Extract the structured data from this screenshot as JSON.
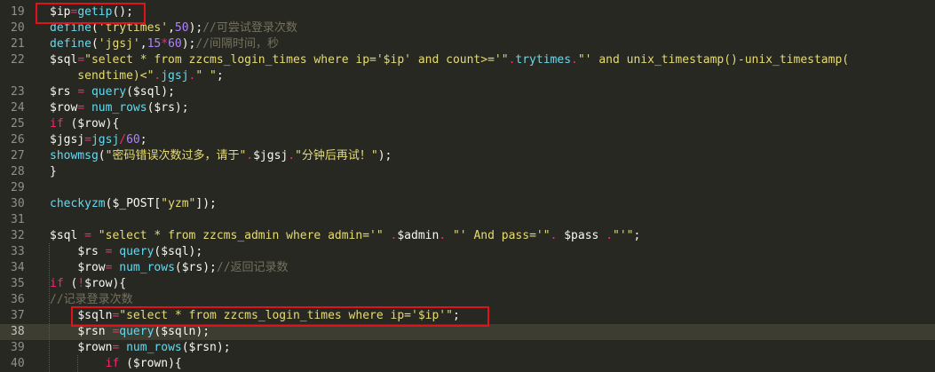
{
  "editor": {
    "lines": [
      {
        "num": "19",
        "tokens": [
          [
            "var",
            "$ip"
          ],
          [
            "op",
            "="
          ],
          [
            "fn",
            "getip"
          ],
          [
            "pu",
            "();"
          ]
        ]
      },
      {
        "num": "20",
        "tokens": [
          [
            "fn",
            "define"
          ],
          [
            "pu",
            "("
          ],
          [
            "str",
            "'trytimes'"
          ],
          [
            "pu",
            ","
          ],
          [
            "num",
            "50"
          ],
          [
            "pu",
            ");"
          ],
          [
            "cm",
            "//可尝试登录次数"
          ]
        ]
      },
      {
        "num": "21",
        "tokens": [
          [
            "fn",
            "define"
          ],
          [
            "pu",
            "("
          ],
          [
            "str",
            "'jgsj'"
          ],
          [
            "pu",
            ","
          ],
          [
            "num",
            "15"
          ],
          [
            "op",
            "*"
          ],
          [
            "num",
            "60"
          ],
          [
            "pu",
            ");"
          ],
          [
            "cm",
            "//间隔时间，秒"
          ]
        ]
      },
      {
        "num": "22",
        "tokens": [
          [
            "var",
            "$sql"
          ],
          [
            "op",
            "="
          ],
          [
            "str",
            "\"select * from zzcms_login_times where ip='$ip' and count>='\""
          ],
          [
            "op",
            "."
          ],
          [
            "fn",
            "trytimes"
          ],
          [
            "op",
            "."
          ],
          [
            "str",
            "\"' and unix_timestamp()-unix_timestamp("
          ]
        ]
      },
      {
        "num": "",
        "tokens": [
          [
            "str",
            "    sendtime)<\""
          ],
          [
            "op",
            "."
          ],
          [
            "fn",
            "jgsj"
          ],
          [
            "op",
            "."
          ],
          [
            "str",
            "\" \""
          ],
          [
            "pu",
            ";"
          ]
        ]
      },
      {
        "num": "23",
        "tokens": [
          [
            "var",
            "$rs"
          ],
          [
            "pu",
            " "
          ],
          [
            "op",
            "="
          ],
          [
            "pu",
            " "
          ],
          [
            "fn",
            "query"
          ],
          [
            "pu",
            "($sql);"
          ]
        ]
      },
      {
        "num": "24",
        "tokens": [
          [
            "var",
            "$row"
          ],
          [
            "op",
            "="
          ],
          [
            "pu",
            " "
          ],
          [
            "fn",
            "num_rows"
          ],
          [
            "pu",
            "($rs);"
          ]
        ]
      },
      {
        "num": "25",
        "tokens": [
          [
            "kw",
            "if"
          ],
          [
            "pu",
            " ($row){"
          ]
        ]
      },
      {
        "num": "26",
        "tokens": [
          [
            "var",
            "$jgsj"
          ],
          [
            "op",
            "="
          ],
          [
            "fn",
            "jgsj"
          ],
          [
            "op",
            "/"
          ],
          [
            "num",
            "60"
          ],
          [
            "pu",
            ";"
          ]
        ]
      },
      {
        "num": "27",
        "tokens": [
          [
            "fn",
            "showmsg"
          ],
          [
            "pu",
            "("
          ],
          [
            "str",
            "\"密码错误次数过多，请于\""
          ],
          [
            "op",
            "."
          ],
          [
            "var",
            "$jgsj"
          ],
          [
            "op",
            "."
          ],
          [
            "str",
            "\"分钟后再试！\""
          ],
          [
            "pu",
            ");"
          ]
        ]
      },
      {
        "num": "28",
        "tokens": [
          [
            "pu",
            "}"
          ]
        ]
      },
      {
        "num": "29",
        "tokens": []
      },
      {
        "num": "30",
        "tokens": [
          [
            "fn",
            "checkyzm"
          ],
          [
            "pu",
            "($_POST["
          ],
          [
            "str",
            "\"yzm\""
          ],
          [
            "pu",
            "]);"
          ]
        ]
      },
      {
        "num": "31",
        "tokens": []
      },
      {
        "num": "32",
        "tokens": [
          [
            "var",
            "$sql"
          ],
          [
            "pu",
            " "
          ],
          [
            "op",
            "="
          ],
          [
            "pu",
            " "
          ],
          [
            "str",
            "\"select * from zzcms_admin where admin='\""
          ],
          [
            "pu",
            " "
          ],
          [
            "op",
            "."
          ],
          [
            "var",
            "$admin"
          ],
          [
            "op",
            "."
          ],
          [
            "pu",
            " "
          ],
          [
            "str",
            "\"' And pass='\""
          ],
          [
            "op",
            "."
          ],
          [
            "pu",
            " "
          ],
          [
            "var",
            "$pass"
          ],
          [
            "pu",
            " "
          ],
          [
            "op",
            "."
          ],
          [
            "str",
            "\"'\""
          ],
          [
            "pu",
            ";"
          ]
        ]
      },
      {
        "num": "33",
        "tokens": [
          [
            "pu",
            "    "
          ],
          [
            "var",
            "$rs"
          ],
          [
            "pu",
            " "
          ],
          [
            "op",
            "="
          ],
          [
            "pu",
            " "
          ],
          [
            "fn",
            "query"
          ],
          [
            "pu",
            "($sql);"
          ]
        ]
      },
      {
        "num": "34",
        "tokens": [
          [
            "pu",
            "    "
          ],
          [
            "var",
            "$row"
          ],
          [
            "op",
            "="
          ],
          [
            "pu",
            " "
          ],
          [
            "fn",
            "num_rows"
          ],
          [
            "pu",
            "($rs);"
          ],
          [
            "cm",
            "//返回记录数"
          ]
        ]
      },
      {
        "num": "35",
        "tokens": [
          [
            "kw",
            "if"
          ],
          [
            "pu",
            " ("
          ],
          [
            "op",
            "!"
          ],
          [
            "pu",
            "$row){"
          ]
        ]
      },
      {
        "num": "36",
        "tokens": [
          [
            "cm",
            "//记录登录次数"
          ]
        ]
      },
      {
        "num": "37",
        "tokens": [
          [
            "pu",
            "    "
          ],
          [
            "var",
            "$sqln"
          ],
          [
            "op",
            "="
          ],
          [
            "str",
            "\"select * from zzcms_login_times where ip='$ip'\""
          ],
          [
            "pu",
            ";"
          ]
        ]
      },
      {
        "num": "38",
        "tokens": [
          [
            "pu",
            "    "
          ],
          [
            "var",
            "$rsn"
          ],
          [
            "pu",
            " "
          ],
          [
            "op",
            "="
          ],
          [
            "fn",
            "query"
          ],
          [
            "pu",
            "($sqln);"
          ]
        ]
      },
      {
        "num": "39",
        "tokens": [
          [
            "pu",
            "    "
          ],
          [
            "var",
            "$rown"
          ],
          [
            "op",
            "="
          ],
          [
            "pu",
            " "
          ],
          [
            "fn",
            "num_rows"
          ],
          [
            "pu",
            "($rsn);"
          ]
        ]
      },
      {
        "num": "40",
        "tokens": [
          [
            "pu",
            "        "
          ],
          [
            "kw",
            "if"
          ],
          [
            "pu",
            " ($rown){"
          ]
        ]
      }
    ],
    "highlighted_line": "38",
    "annotation_color": "#e2121b"
  }
}
